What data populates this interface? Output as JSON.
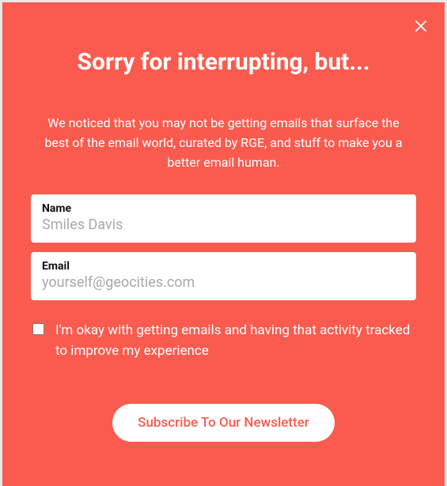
{
  "modal": {
    "title": "Sorry for interrupting, but...",
    "description": "We noticed that you may not be getting emails that surface the best of the email world, curated by RGE, and stuff to make you a better email human.",
    "name_field": {
      "label": "Name",
      "placeholder": "Smiles Davis",
      "value": ""
    },
    "email_field": {
      "label": "Email",
      "placeholder": "yourself@geocities.com",
      "value": ""
    },
    "consent_label": "I'm okay with getting emails and having that activity tracked to improve my experience",
    "submit_label": "Subscribe To Our Newsletter"
  }
}
